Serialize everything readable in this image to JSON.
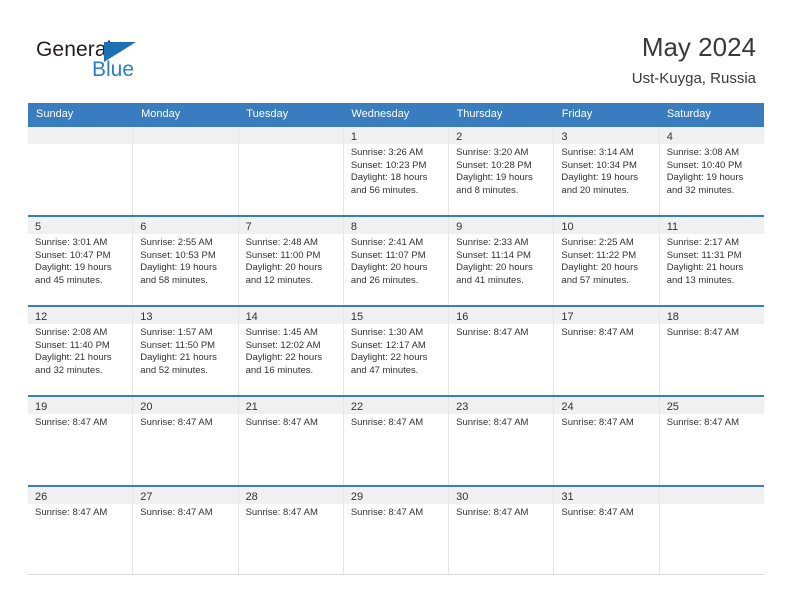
{
  "brand": {
    "name_top": "General",
    "name_bottom": "Blue",
    "accent_color": "#2b7fc4"
  },
  "header": {
    "title": "May 2024",
    "subtitle": "Ust-Kuyga, Russia"
  },
  "theme": {
    "header_blue": "#3a7cc0",
    "date_band_gray": "#f0f0f0",
    "text_color": "#333333"
  },
  "weekdays": [
    "Sunday",
    "Monday",
    "Tuesday",
    "Wednesday",
    "Thursday",
    "Friday",
    "Saturday"
  ],
  "weeks": [
    [
      {
        "date": "",
        "lines": []
      },
      {
        "date": "",
        "lines": []
      },
      {
        "date": "",
        "lines": []
      },
      {
        "date": "1",
        "lines": [
          "Sunrise: 3:26 AM",
          "Sunset: 10:23 PM",
          "Daylight: 18 hours",
          "and 56 minutes."
        ]
      },
      {
        "date": "2",
        "lines": [
          "Sunrise: 3:20 AM",
          "Sunset: 10:28 PM",
          "Daylight: 19 hours",
          "and 8 minutes."
        ]
      },
      {
        "date": "3",
        "lines": [
          "Sunrise: 3:14 AM",
          "Sunset: 10:34 PM",
          "Daylight: 19 hours",
          "and 20 minutes."
        ]
      },
      {
        "date": "4",
        "lines": [
          "Sunrise: 3:08 AM",
          "Sunset: 10:40 PM",
          "Daylight: 19 hours",
          "and 32 minutes."
        ]
      }
    ],
    [
      {
        "date": "5",
        "lines": [
          "Sunrise: 3:01 AM",
          "Sunset: 10:47 PM",
          "Daylight: 19 hours",
          "and 45 minutes."
        ]
      },
      {
        "date": "6",
        "lines": [
          "Sunrise: 2:55 AM",
          "Sunset: 10:53 PM",
          "Daylight: 19 hours",
          "and 58 minutes."
        ]
      },
      {
        "date": "7",
        "lines": [
          "Sunrise: 2:48 AM",
          "Sunset: 11:00 PM",
          "Daylight: 20 hours",
          "and 12 minutes."
        ]
      },
      {
        "date": "8",
        "lines": [
          "Sunrise: 2:41 AM",
          "Sunset: 11:07 PM",
          "Daylight: 20 hours",
          "and 26 minutes."
        ]
      },
      {
        "date": "9",
        "lines": [
          "Sunrise: 2:33 AM",
          "Sunset: 11:14 PM",
          "Daylight: 20 hours",
          "and 41 minutes."
        ]
      },
      {
        "date": "10",
        "lines": [
          "Sunrise: 2:25 AM",
          "Sunset: 11:22 PM",
          "Daylight: 20 hours",
          "and 57 minutes."
        ]
      },
      {
        "date": "11",
        "lines": [
          "Sunrise: 2:17 AM",
          "Sunset: 11:31 PM",
          "Daylight: 21 hours",
          "and 13 minutes."
        ]
      }
    ],
    [
      {
        "date": "12",
        "lines": [
          "Sunrise: 2:08 AM",
          "Sunset: 11:40 PM",
          "Daylight: 21 hours",
          "and 32 minutes."
        ]
      },
      {
        "date": "13",
        "lines": [
          "Sunrise: 1:57 AM",
          "Sunset: 11:50 PM",
          "Daylight: 21 hours",
          "and 52 minutes."
        ]
      },
      {
        "date": "14",
        "lines": [
          "Sunrise: 1:45 AM",
          "Sunset: 12:02 AM",
          "Daylight: 22 hours",
          "and 16 minutes."
        ]
      },
      {
        "date": "15",
        "lines": [
          "Sunrise: 1:30 AM",
          "Sunset: 12:17 AM",
          "Daylight: 22 hours",
          "and 47 minutes."
        ]
      },
      {
        "date": "16",
        "lines": [
          "Sunrise: 8:47 AM"
        ]
      },
      {
        "date": "17",
        "lines": [
          "Sunrise: 8:47 AM"
        ]
      },
      {
        "date": "18",
        "lines": [
          "Sunrise: 8:47 AM"
        ]
      }
    ],
    [
      {
        "date": "19",
        "lines": [
          "Sunrise: 8:47 AM"
        ]
      },
      {
        "date": "20",
        "lines": [
          "Sunrise: 8:47 AM"
        ]
      },
      {
        "date": "21",
        "lines": [
          "Sunrise: 8:47 AM"
        ]
      },
      {
        "date": "22",
        "lines": [
          "Sunrise: 8:47 AM"
        ]
      },
      {
        "date": "23",
        "lines": [
          "Sunrise: 8:47 AM"
        ]
      },
      {
        "date": "24",
        "lines": [
          "Sunrise: 8:47 AM"
        ]
      },
      {
        "date": "25",
        "lines": [
          "Sunrise: 8:47 AM"
        ]
      }
    ],
    [
      {
        "date": "26",
        "lines": [
          "Sunrise: 8:47 AM"
        ]
      },
      {
        "date": "27",
        "lines": [
          "Sunrise: 8:47 AM"
        ]
      },
      {
        "date": "28",
        "lines": [
          "Sunrise: 8:47 AM"
        ]
      },
      {
        "date": "29",
        "lines": [
          "Sunrise: 8:47 AM"
        ]
      },
      {
        "date": "30",
        "lines": [
          "Sunrise: 8:47 AM"
        ]
      },
      {
        "date": "31",
        "lines": [
          "Sunrise: 8:47 AM"
        ]
      },
      {
        "date": "",
        "lines": []
      }
    ]
  ]
}
